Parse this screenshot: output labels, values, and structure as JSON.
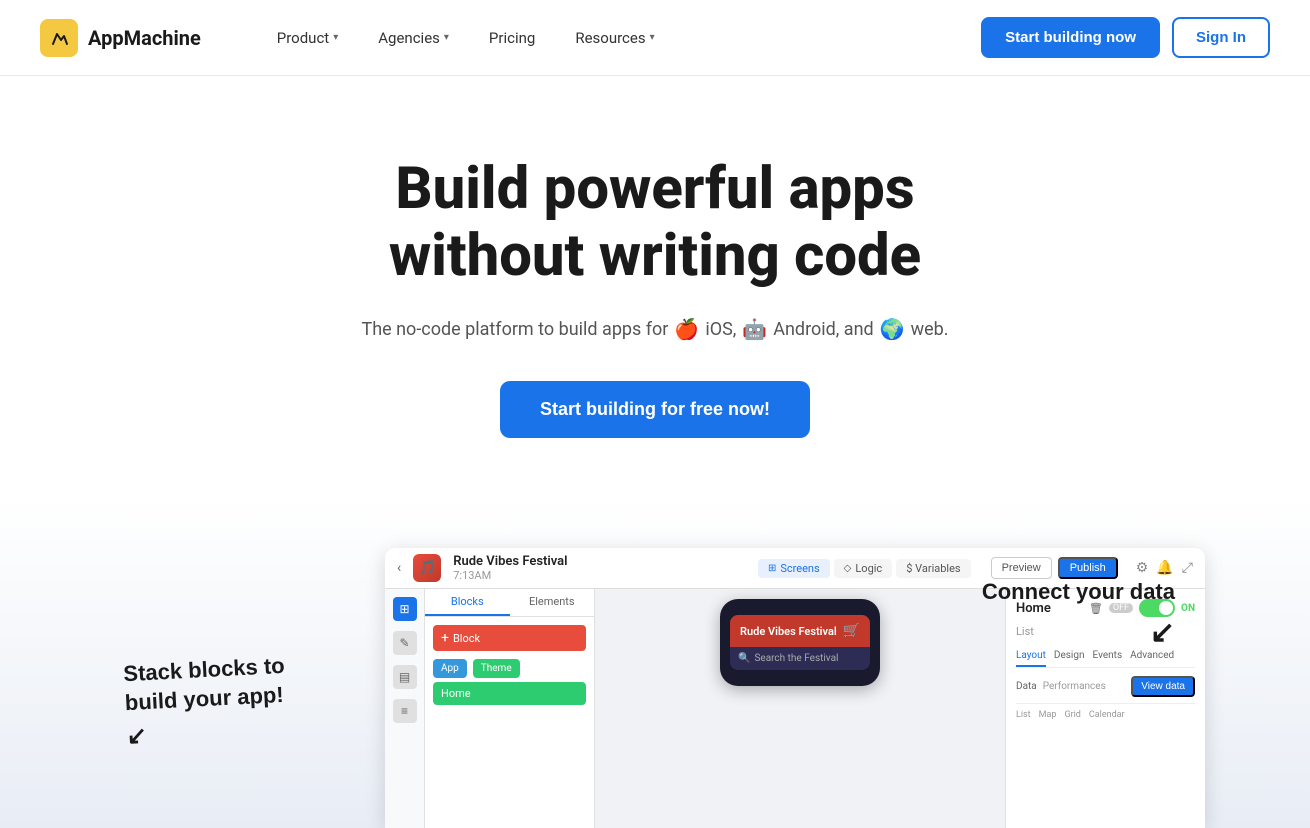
{
  "brand": {
    "name": "AppMachine",
    "logo_emoji": "🟡",
    "logo_bg": "#f5c842"
  },
  "nav": {
    "product_label": "Product",
    "agencies_label": "Agencies",
    "pricing_label": "Pricing",
    "resources_label": "Resources",
    "cta_primary": "Start building now",
    "cta_secondary": "Sign In"
  },
  "hero": {
    "title_line1": "Build powerful apps",
    "title_line2": "without writing code",
    "subtitle_text": "The no-code platform to build apps for",
    "ios_emoji": "🍎",
    "ios_label": "iOS,",
    "android_emoji": "🤖",
    "android_label": "Android, and",
    "web_emoji": "🌍",
    "web_label": "web.",
    "cta_label": "Start building for free now!"
  },
  "preview": {
    "annotation_left_line1": "Stack blocks to",
    "annotation_left_line2": "build your app!",
    "annotation_right": "Connect your data",
    "mockup": {
      "app_name": "Rude Vibes Festival",
      "app_time": "7:13AM",
      "tab_screens": "Screens",
      "tab_logic": "Logic",
      "tab_variables": "$ Variables",
      "btn_preview": "Preview",
      "btn_publish": "Publish",
      "panel_tab1": "Blocks",
      "panel_tab2": "Elements",
      "block_add": "+ Block",
      "theme_btn1": "App",
      "theme_btn2": "Theme",
      "home_btn": "Home",
      "phone_app_name": "Rude Vibes Festival",
      "phone_search_placeholder": "Search the Festival",
      "right_panel_title": "Home",
      "right_panel_subtitle": "List",
      "right_tab1": "Layout",
      "right_tab2": "Design",
      "right_tab3": "Events",
      "right_tab4": "Advanced",
      "data_label": "Data",
      "data_value": "Performances",
      "view_data_btn": "View data",
      "toggle_on": "ON",
      "toggle_off": "OFF"
    }
  }
}
